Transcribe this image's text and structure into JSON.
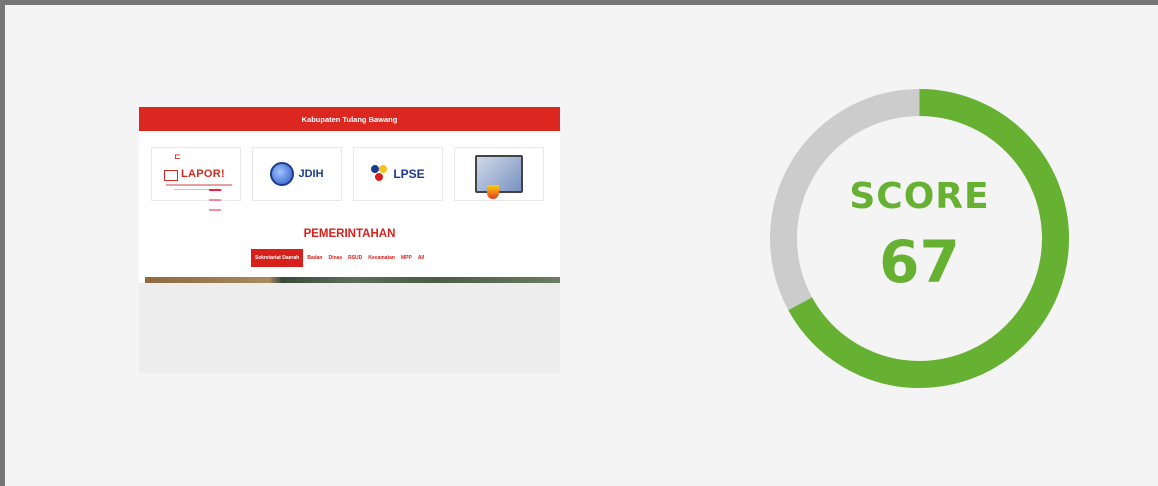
{
  "website_preview": {
    "top_bar_title": "Kabupaten Tulang Bawang",
    "logos": [
      {
        "name": "LAPOR!"
      },
      {
        "name": "JDIH"
      },
      {
        "name": "LPSE"
      }
    ],
    "section_heading": "PEMERINTAHAN",
    "tabs": [
      "Sekretariat Daerah",
      "Badan",
      "Dinas",
      "RSUD",
      "Kecamatan",
      "MPP",
      "All"
    ],
    "active_tab": "Sekretariat Daerah"
  },
  "score": {
    "label": "SCORE",
    "value": "67",
    "percent": 67,
    "color": "#66b032",
    "track_color": "#cccccc"
  }
}
